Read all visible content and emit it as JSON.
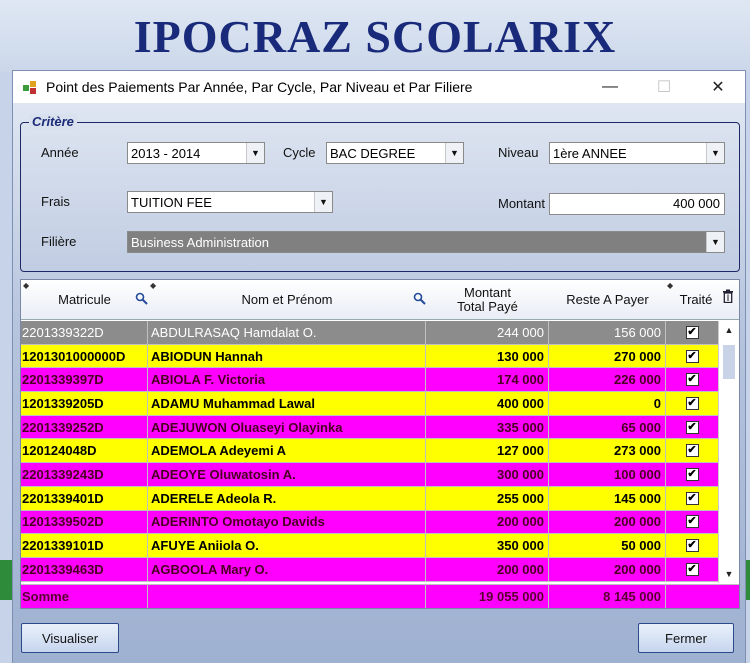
{
  "app": {
    "title": "IPOCRAZ SCOLARIX"
  },
  "window": {
    "title": "Point des Paiements Par Année, Par Cycle, Par Niveau et Par Filiere",
    "minimize": "—",
    "maximize": "☐",
    "close": "✕"
  },
  "criteria": {
    "legend": "Critère",
    "annee_label": "Année",
    "annee_value": "2013 - 2014",
    "cycle_label": "Cycle",
    "cycle_value": "BAC DEGREE",
    "niveau_label": "Niveau",
    "niveau_value": "1ère ANNEE",
    "frais_label": "Frais",
    "frais_value": "TUITION FEE",
    "montant_label": "Montant",
    "montant_value": "400 000",
    "filiere_label": "Filière",
    "filiere_value": "Business Administration"
  },
  "grid": {
    "headers": {
      "matricule": "Matricule",
      "nom": "Nom et Prénom",
      "montant_line1": "Montant",
      "montant_line2": "Total Payé",
      "reste": "Reste A Payer",
      "traite": "Traité"
    },
    "rows": [
      {
        "matricule": "2201339322D",
        "nom": "ABDULRASAQ Hamdalat O.",
        "total": "244 000",
        "reste": "156 000",
        "traite": "✔",
        "style": "sel"
      },
      {
        "matricule": "1201301000000D",
        "nom": "ABIODUN Hannah",
        "total": "130 000",
        "reste": "270 000",
        "traite": "✔",
        "style": "yellow"
      },
      {
        "matricule": "2201339397D",
        "nom": "ABIOLA F. Victoria",
        "total": "174 000",
        "reste": "226 000",
        "traite": "✔",
        "style": "magenta"
      },
      {
        "matricule": "1201339205D",
        "nom": "ADAMU Muhammad Lawal",
        "total": "400 000",
        "reste": "0",
        "traite": "✔",
        "style": "yellow"
      },
      {
        "matricule": "2201339252D",
        "nom": "ADEJUWON Oluaseyi Olayinka",
        "total": "335 000",
        "reste": "65 000",
        "traite": "✔",
        "style": "magenta"
      },
      {
        "matricule": "120124048D",
        "nom": "ADEMOLA Adeyemi A",
        "total": "127 000",
        "reste": "273 000",
        "traite": "✔",
        "style": "yellow"
      },
      {
        "matricule": "2201339243D",
        "nom": "ADEOYE Oluwatosin A.",
        "total": "300 000",
        "reste": "100 000",
        "traite": "✔",
        "style": "magenta"
      },
      {
        "matricule": "2201339401D",
        "nom": "ADERELE Adeola R.",
        "total": "255 000",
        "reste": "145 000",
        "traite": "✔",
        "style": "yellow"
      },
      {
        "matricule": "1201339502D",
        "nom": "ADERINTO Omotayo Davids",
        "total": "200 000",
        "reste": "200 000",
        "traite": "✔",
        "style": "magenta"
      },
      {
        "matricule": "2201339101D",
        "nom": "AFUYE Aniiola O.",
        "total": "350 000",
        "reste": "50 000",
        "traite": "✔",
        "style": "yellow"
      },
      {
        "matricule": "2201339463D",
        "nom": "AGBOOLA Mary O.",
        "total": "200 000",
        "reste": "200 000",
        "traite": "✔",
        "style": "magenta"
      }
    ],
    "summary": {
      "label": "Somme",
      "total": "19 055 000",
      "reste": "8 145 000"
    }
  },
  "buttons": {
    "visualiser": "Visualiser",
    "fermer": "Fermer"
  },
  "colors": {
    "selected_row": "#8c8c8c",
    "yellow_row": "#ffff00",
    "magenta_row": "#ff00ff",
    "title_blue": "#1a2a7a"
  }
}
